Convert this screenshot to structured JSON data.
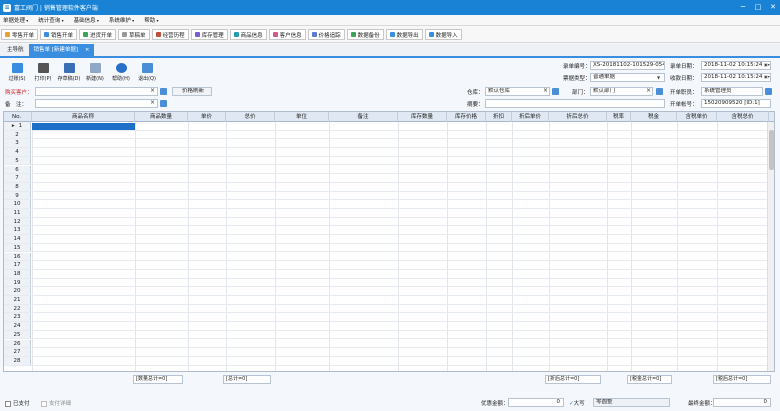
{
  "window": {
    "title": "富工阀门 | 销售管理软件客户端",
    "min": "─",
    "max": "□",
    "close": "✕"
  },
  "menu": [
    "单据处理",
    "统计查询",
    "基础信息",
    "系统维护",
    "帮助"
  ],
  "quick": [
    {
      "label": "零售开单",
      "color": "#e8a23a"
    },
    {
      "label": "销售开单",
      "color": "#3a8ee0"
    },
    {
      "label": "进货开单",
      "color": "#3aa655"
    },
    {
      "label": "草稿单",
      "color": "#999999"
    },
    {
      "label": "经营历程",
      "color": "#c04f3a"
    },
    {
      "label": "库存管理",
      "color": "#7a5bd0"
    },
    {
      "label": "商品信息",
      "color": "#2a9bb5"
    },
    {
      "label": "客户信息",
      "color": "#d05b8a"
    },
    {
      "label": "价格追踪",
      "color": "#5b7ad0"
    },
    {
      "label": "数据备份",
      "color": "#3aa655"
    },
    {
      "label": "数据导出",
      "color": "#3a8ee0"
    },
    {
      "label": "数据导入",
      "color": "#3a8ee0"
    }
  ],
  "tabs": {
    "home": "主导航",
    "active": "销售单 [新建单据]",
    "close": "×"
  },
  "toolbar": [
    {
      "label": "过账(S)",
      "icon": "post-icon",
      "color": "#3a8ee0"
    },
    {
      "label": "打印(P)",
      "icon": "printer-icon",
      "color": "#555555"
    },
    {
      "label": "存草稿(D)",
      "icon": "save-icon",
      "color": "#3a6fb5"
    },
    {
      "label": "新建(N)",
      "icon": "new-doc-icon",
      "color": "#8fa8c8"
    },
    {
      "label": "帮助(H)",
      "icon": "help-icon",
      "color": "#2a6fc8"
    },
    {
      "label": "退出(Q)",
      "icon": "exit-icon",
      "color": "#4a8ed8"
    }
  ],
  "form": {
    "doc_no_label": "录单编号：",
    "doc_no": "XS-20181102-101529-0542",
    "doc_type_label": "票据类型：",
    "doc_type": "普通单据",
    "entry_date_label": "录单日期：",
    "entry_date": "2018-11-02 10:15:24",
    "recv_date_label": "收款日期：",
    "recv_date": "2018-11-02 10:15:24",
    "buyer_label": "购买客户：",
    "buyer": "",
    "price_refresh": "价格刷新",
    "warehouse_label": "仓库：",
    "warehouse": "默认仓库",
    "dept_label": "部门：",
    "dept": "默认部门",
    "staff_label": "开单职员：",
    "staff": "系统管理员",
    "note_label": "备　注：",
    "note": "",
    "summary_label": "摘要：",
    "summary": "",
    "account_label": "开单帐号：",
    "account": "15020909520 [ID:1]"
  },
  "grid": {
    "columns": [
      "No.",
      "商品名称",
      "商品数量",
      "单价",
      "总价",
      "单位",
      "备注",
      "库存数量",
      "库存价格",
      "折扣",
      "折后单价",
      "折后总价",
      "税率",
      "税金",
      "含税单价",
      "含税总价"
    ],
    "rows": [
      "1",
      "2",
      "3",
      "4",
      "5",
      "6",
      "7",
      "8",
      "9",
      "10",
      "11",
      "12",
      "13",
      "14",
      "15",
      "16",
      "17",
      "18",
      "19",
      "20",
      "21",
      "22",
      "23",
      "24",
      "25",
      "26",
      "27",
      "28"
    ],
    "current_row_marker": "▸"
  },
  "sums": {
    "qty": "[数量总计=0]",
    "total": "[总计=0]",
    "disc_total": "[折后总计=0]",
    "tax": "[税金总计=0]",
    "tax_total": "[税后总计=0]"
  },
  "footer": {
    "paid": "已支付",
    "detail": "支付详细",
    "discount_label": "优惠金额：",
    "discount": "0",
    "caps": "大写",
    "caps_value": "零圆整",
    "final_label": "最终金额：",
    "final": "0"
  }
}
